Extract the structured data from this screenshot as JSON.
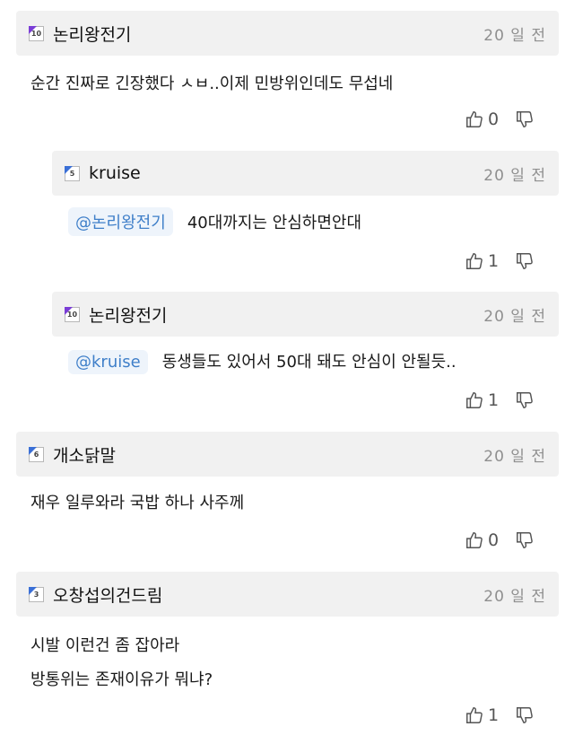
{
  "comments": [
    {
      "nick": "논리왕전기",
      "level": "10",
      "time": "20 일 전",
      "text": "순간 진짜로 긴장했다 ㅅㅂ..이제 민방위인데도 무섭네",
      "likes": "0"
    },
    {
      "nick": "kruise",
      "level": "5",
      "time": "20 일 전",
      "mention": "@논리왕전기",
      "text": "40대까지는 안심하면안대",
      "likes": "1"
    },
    {
      "nick": "논리왕전기",
      "level": "10",
      "time": "20 일 전",
      "mention": "@kruise",
      "text": "동생들도 있어서 50대 돼도 안심이 안될듯..",
      "likes": "1"
    },
    {
      "nick": "개소닭말",
      "level": "6",
      "time": "20 일 전",
      "text": "재우 일루와라 국밥 하나 사주께",
      "likes": "0"
    },
    {
      "nick": "오창섭의건드림",
      "level": "3",
      "time": "20 일 전",
      "text_lines": [
        "시발 이런건 좀 잡아라",
        "방통위는 존재이유가 뭐냐?"
      ],
      "likes": "1"
    }
  ],
  "icons": {
    "like": "thumbs-up-icon",
    "dislike": "thumbs-down-icon"
  },
  "colors": {
    "mention_text": "#3f7fc9",
    "mention_bg": "#eef4fb",
    "header_bg": "#f1f1f1",
    "level_purple": "#7a3dd6",
    "level_blue": "#3a6fd6"
  }
}
